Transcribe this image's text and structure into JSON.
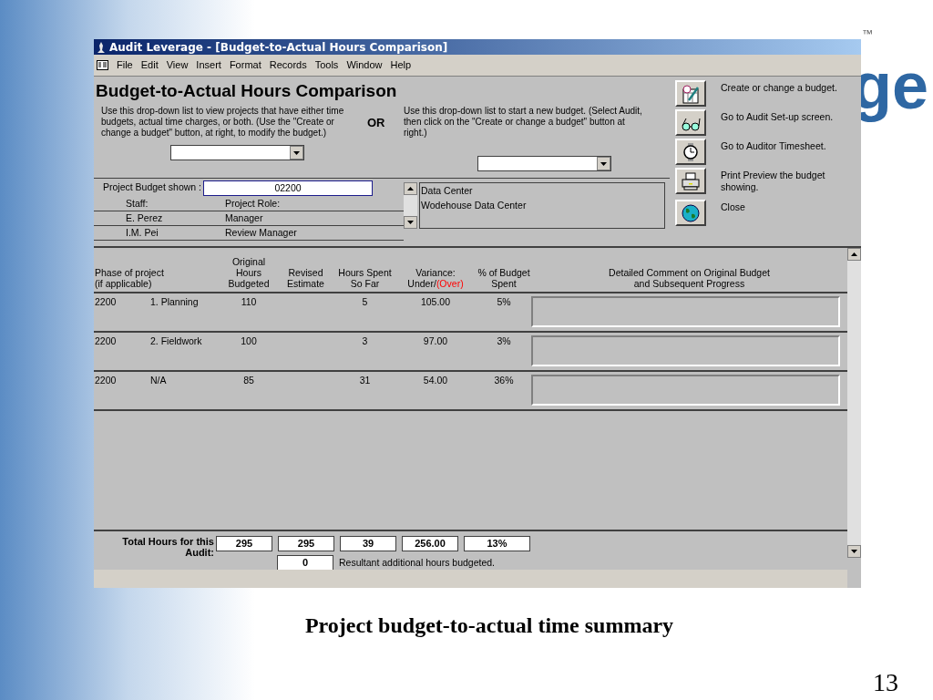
{
  "slide": {
    "logo_fragment": "ge",
    "logo_mark": "™",
    "caption": "Project budget-to-actual time summary",
    "page_number": "13"
  },
  "window": {
    "title": "Audit Leverage - [Budget-to-Actual Hours Comparison]",
    "menu": [
      "File",
      "Edit",
      "View",
      "Insert",
      "Format",
      "Records",
      "Tools",
      "Window",
      "Help"
    ]
  },
  "form": {
    "heading": "Budget-to-Actual Hours Comparison",
    "left_instructions": "Use this drop-down list to view projects that have either time budgets,  actual time charges, or both.  (Use the \"Create or change a budget\" button, at right, to modify the budget.)",
    "or_label": "OR",
    "right_instructions": "Use this drop-down list to start a new budget. (Select Audit, then click on the \"Create or change a budget\" button at right.)",
    "project_budget": {
      "label": "Project Budget shown :",
      "value": "02200"
    },
    "staff": {
      "columns": [
        "Staff:",
        "Project Role:"
      ],
      "rows": [
        {
          "name": "E. Perez",
          "role": "Manager"
        },
        {
          "name": "I.M. Pei",
          "role": "Review Manager"
        }
      ]
    },
    "locations": [
      "Data Center",
      "Wodehouse Data Center"
    ]
  },
  "actions": [
    {
      "kind": "budget",
      "label": "Create or change a budget."
    },
    {
      "kind": "glasses",
      "label": "Go to Audit Set-up screen."
    },
    {
      "kind": "watch",
      "label": "Go to Auditor Timesheet."
    },
    {
      "kind": "printer",
      "label": "Print Preview the budget showing."
    },
    {
      "kind": "globe",
      "label": "Close"
    }
  ],
  "phases": {
    "columns": [
      {
        "label": "Phase of project\n(if applicable)"
      },
      {
        "label": "Original\nHours\nBudgeted"
      },
      {
        "label": "Revised\nEstimate"
      },
      {
        "label": "Hours Spent\nSo Far"
      },
      {
        "label": "Variance:\nUnder/",
        "suffix": "(Over)"
      },
      {
        "label": "% of Budget\nSpent"
      },
      {
        "label": "Detailed Comment on Original Budget\nand Subsequent Progress"
      }
    ],
    "rows": [
      {
        "code": "2200",
        "phase": "1. Planning",
        "original": "110",
        "hours_spent": "5",
        "variance": "105.00",
        "percent": "5%"
      },
      {
        "code": "2200",
        "phase": "2. Fieldwork",
        "original": "100",
        "hours_spent": "3",
        "variance": "97.00",
        "percent": "3%"
      },
      {
        "code": "2200",
        "phase": "N/A",
        "original": "85",
        "hours_spent": "31",
        "variance": "54.00",
        "percent": "36%"
      }
    ]
  },
  "totals": {
    "label": "Total Hours for this Audit:",
    "values": [
      "295",
      "295",
      "39",
      "256.00",
      "13%"
    ],
    "additional": {
      "value": "0",
      "label": "Resultant additional hours budgeted."
    }
  }
}
